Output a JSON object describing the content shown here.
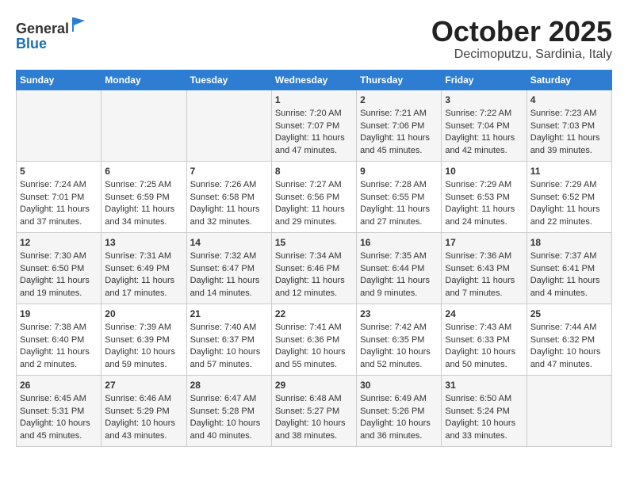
{
  "header": {
    "logo_line1": "General",
    "logo_line2": "Blue",
    "month": "October 2025",
    "location": "Decimoputzu, Sardinia, Italy"
  },
  "weekdays": [
    "Sunday",
    "Monday",
    "Tuesday",
    "Wednesday",
    "Thursday",
    "Friday",
    "Saturday"
  ],
  "weeks": [
    [
      {
        "day": "",
        "text": ""
      },
      {
        "day": "",
        "text": ""
      },
      {
        "day": "",
        "text": ""
      },
      {
        "day": "1",
        "text": "Sunrise: 7:20 AM\nSunset: 7:07 PM\nDaylight: 11 hours and 47 minutes."
      },
      {
        "day": "2",
        "text": "Sunrise: 7:21 AM\nSunset: 7:06 PM\nDaylight: 11 hours and 45 minutes."
      },
      {
        "day": "3",
        "text": "Sunrise: 7:22 AM\nSunset: 7:04 PM\nDaylight: 11 hours and 42 minutes."
      },
      {
        "day": "4",
        "text": "Sunrise: 7:23 AM\nSunset: 7:03 PM\nDaylight: 11 hours and 39 minutes."
      }
    ],
    [
      {
        "day": "5",
        "text": "Sunrise: 7:24 AM\nSunset: 7:01 PM\nDaylight: 11 hours and 37 minutes."
      },
      {
        "day": "6",
        "text": "Sunrise: 7:25 AM\nSunset: 6:59 PM\nDaylight: 11 hours and 34 minutes."
      },
      {
        "day": "7",
        "text": "Sunrise: 7:26 AM\nSunset: 6:58 PM\nDaylight: 11 hours and 32 minutes."
      },
      {
        "day": "8",
        "text": "Sunrise: 7:27 AM\nSunset: 6:56 PM\nDaylight: 11 hours and 29 minutes."
      },
      {
        "day": "9",
        "text": "Sunrise: 7:28 AM\nSunset: 6:55 PM\nDaylight: 11 hours and 27 minutes."
      },
      {
        "day": "10",
        "text": "Sunrise: 7:29 AM\nSunset: 6:53 PM\nDaylight: 11 hours and 24 minutes."
      },
      {
        "day": "11",
        "text": "Sunrise: 7:29 AM\nSunset: 6:52 PM\nDaylight: 11 hours and 22 minutes."
      }
    ],
    [
      {
        "day": "12",
        "text": "Sunrise: 7:30 AM\nSunset: 6:50 PM\nDaylight: 11 hours and 19 minutes."
      },
      {
        "day": "13",
        "text": "Sunrise: 7:31 AM\nSunset: 6:49 PM\nDaylight: 11 hours and 17 minutes."
      },
      {
        "day": "14",
        "text": "Sunrise: 7:32 AM\nSunset: 6:47 PM\nDaylight: 11 hours and 14 minutes."
      },
      {
        "day": "15",
        "text": "Sunrise: 7:34 AM\nSunset: 6:46 PM\nDaylight: 11 hours and 12 minutes."
      },
      {
        "day": "16",
        "text": "Sunrise: 7:35 AM\nSunset: 6:44 PM\nDaylight: 11 hours and 9 minutes."
      },
      {
        "day": "17",
        "text": "Sunrise: 7:36 AM\nSunset: 6:43 PM\nDaylight: 11 hours and 7 minutes."
      },
      {
        "day": "18",
        "text": "Sunrise: 7:37 AM\nSunset: 6:41 PM\nDaylight: 11 hours and 4 minutes."
      }
    ],
    [
      {
        "day": "19",
        "text": "Sunrise: 7:38 AM\nSunset: 6:40 PM\nDaylight: 11 hours and 2 minutes."
      },
      {
        "day": "20",
        "text": "Sunrise: 7:39 AM\nSunset: 6:39 PM\nDaylight: 10 hours and 59 minutes."
      },
      {
        "day": "21",
        "text": "Sunrise: 7:40 AM\nSunset: 6:37 PM\nDaylight: 10 hours and 57 minutes."
      },
      {
        "day": "22",
        "text": "Sunrise: 7:41 AM\nSunset: 6:36 PM\nDaylight: 10 hours and 55 minutes."
      },
      {
        "day": "23",
        "text": "Sunrise: 7:42 AM\nSunset: 6:35 PM\nDaylight: 10 hours and 52 minutes."
      },
      {
        "day": "24",
        "text": "Sunrise: 7:43 AM\nSunset: 6:33 PM\nDaylight: 10 hours and 50 minutes."
      },
      {
        "day": "25",
        "text": "Sunrise: 7:44 AM\nSunset: 6:32 PM\nDaylight: 10 hours and 47 minutes."
      }
    ],
    [
      {
        "day": "26",
        "text": "Sunrise: 6:45 AM\nSunset: 5:31 PM\nDaylight: 10 hours and 45 minutes."
      },
      {
        "day": "27",
        "text": "Sunrise: 6:46 AM\nSunset: 5:29 PM\nDaylight: 10 hours and 43 minutes."
      },
      {
        "day": "28",
        "text": "Sunrise: 6:47 AM\nSunset: 5:28 PM\nDaylight: 10 hours and 40 minutes."
      },
      {
        "day": "29",
        "text": "Sunrise: 6:48 AM\nSunset: 5:27 PM\nDaylight: 10 hours and 38 minutes."
      },
      {
        "day": "30",
        "text": "Sunrise: 6:49 AM\nSunset: 5:26 PM\nDaylight: 10 hours and 36 minutes."
      },
      {
        "day": "31",
        "text": "Sunrise: 6:50 AM\nSunset: 5:24 PM\nDaylight: 10 hours and 33 minutes."
      },
      {
        "day": "",
        "text": ""
      }
    ]
  ]
}
